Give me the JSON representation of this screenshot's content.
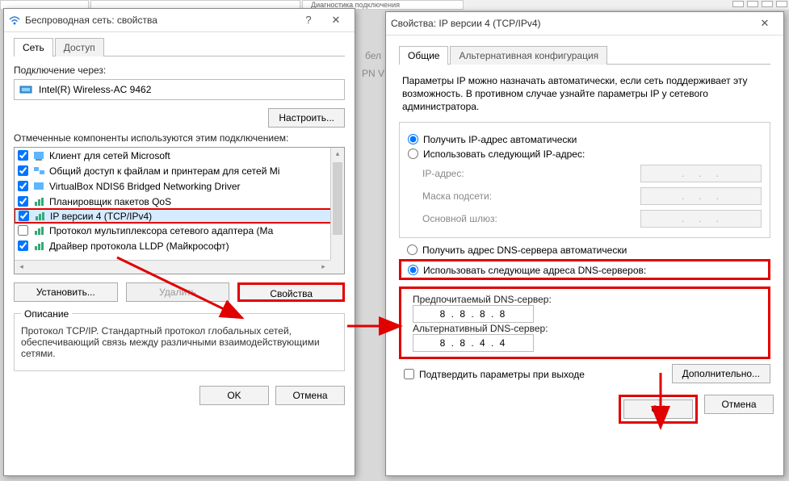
{
  "top_bg_tabs": [
    "Диагностика подключения"
  ],
  "bg_fragments": {
    "bel": "бел",
    "pnv": "PN V"
  },
  "dlg1": {
    "title": "Беспроводная сеть: свойства",
    "tabs": {
      "net": "Сеть",
      "access": "Доступ"
    },
    "connect_via": "Подключение через:",
    "adapter": "Intel(R) Wireless-AC 9462",
    "configure_btn": "Настроить...",
    "components_label": "Отмеченные компоненты используются этим подключением:",
    "items": [
      {
        "checked": true,
        "icon": "client",
        "label": "Клиент для сетей Microsoft"
      },
      {
        "checked": true,
        "icon": "share",
        "label": "Общий доступ к файлам и принтерам для сетей Mi"
      },
      {
        "checked": true,
        "icon": "client",
        "label": "VirtualBox NDIS6 Bridged Networking Driver"
      },
      {
        "checked": true,
        "icon": "qos",
        "label": "Планировщик пакетов QoS"
      },
      {
        "checked": true,
        "icon": "ipv4",
        "label": "IP версии 4 (TCP/IPv4)",
        "selected": true
      },
      {
        "checked": false,
        "icon": "mux",
        "label": "Протокол мультиплексора сетевого адаптера (Ма"
      },
      {
        "checked": true,
        "icon": "lldp",
        "label": "Драйвер протокола LLDP (Майкрософт)"
      }
    ],
    "install_btn": "Установить...",
    "remove_btn": "Удалить",
    "props_btn": "Свойства",
    "desc_label": "Описание",
    "desc_text": "Протокол TCP/IP. Стандартный протокол глобальных сетей, обеспечивающий связь между различными взаимодействующими сетями.",
    "ok": "OK",
    "cancel": "Отмена"
  },
  "dlg2": {
    "title": "Свойства: IP версии 4 (TCP/IPv4)",
    "tabs": {
      "general": "Общие",
      "alt": "Альтернативная конфигурация"
    },
    "desc": "Параметры IP можно назначать автоматически, если сеть поддерживает эту возможность. В противном случае узнайте параметры IP у сетевого администратора.",
    "ip_auto": "Получить IP-адрес автоматически",
    "ip_manual": "Использовать следующий IP-адрес:",
    "ip_label": "IP-адрес:",
    "mask_label": "Маска подсети:",
    "gw_label": "Основной шлюз:",
    "dns_auto": "Получить адрес DNS-сервера автоматически",
    "dns_manual": "Использовать следующие адреса DNS-серверов:",
    "dns_pref": "Предпочитаемый DNS-сервер:",
    "dns_alt": "Альтернативный DNS-сервер:",
    "dns_pref_val": "8 . 8 . 8 . 8",
    "dns_alt_val": "8 . 8 . 4 . 4",
    "confirm_exit": "Подтвердить параметры при выходе",
    "advanced": "Дополнительно...",
    "ok": "OK",
    "cancel": "Отмена"
  }
}
